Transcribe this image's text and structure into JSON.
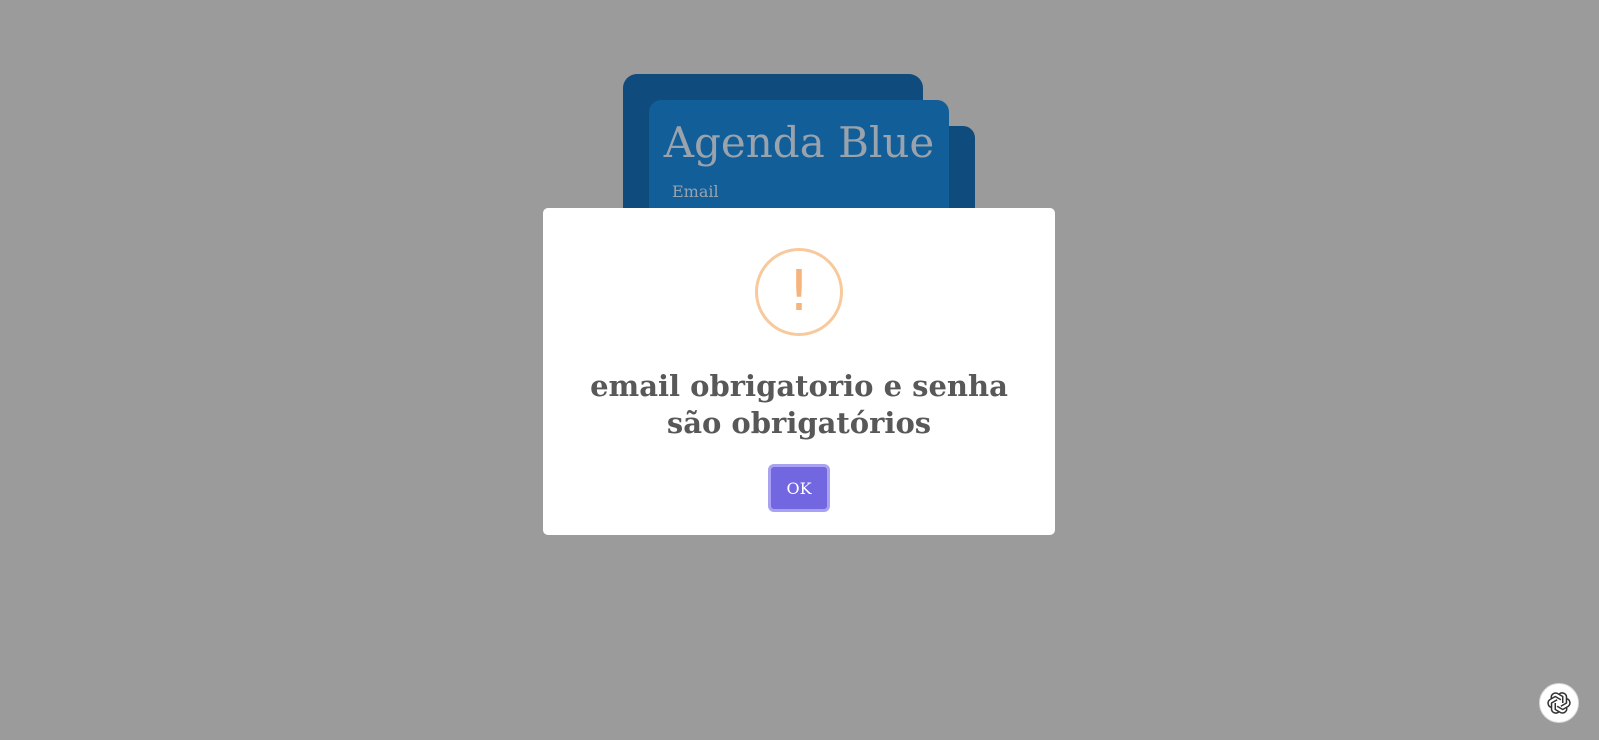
{
  "background_card": {
    "title": "Agenda Blue",
    "email_label": "Email"
  },
  "alert": {
    "icon": "warning-icon",
    "icon_glyph": "!",
    "message": "email obrigatorio e senha são obrigatórios",
    "ok_label": "OK",
    "icon_color": "#f8c99c",
    "button_color": "#7267e0"
  },
  "assistant": {
    "icon": "openai-icon"
  },
  "colors": {
    "overlay": "#9b9b9b",
    "card_dark": "#0f4b7d",
    "card_front": "#125e99"
  }
}
